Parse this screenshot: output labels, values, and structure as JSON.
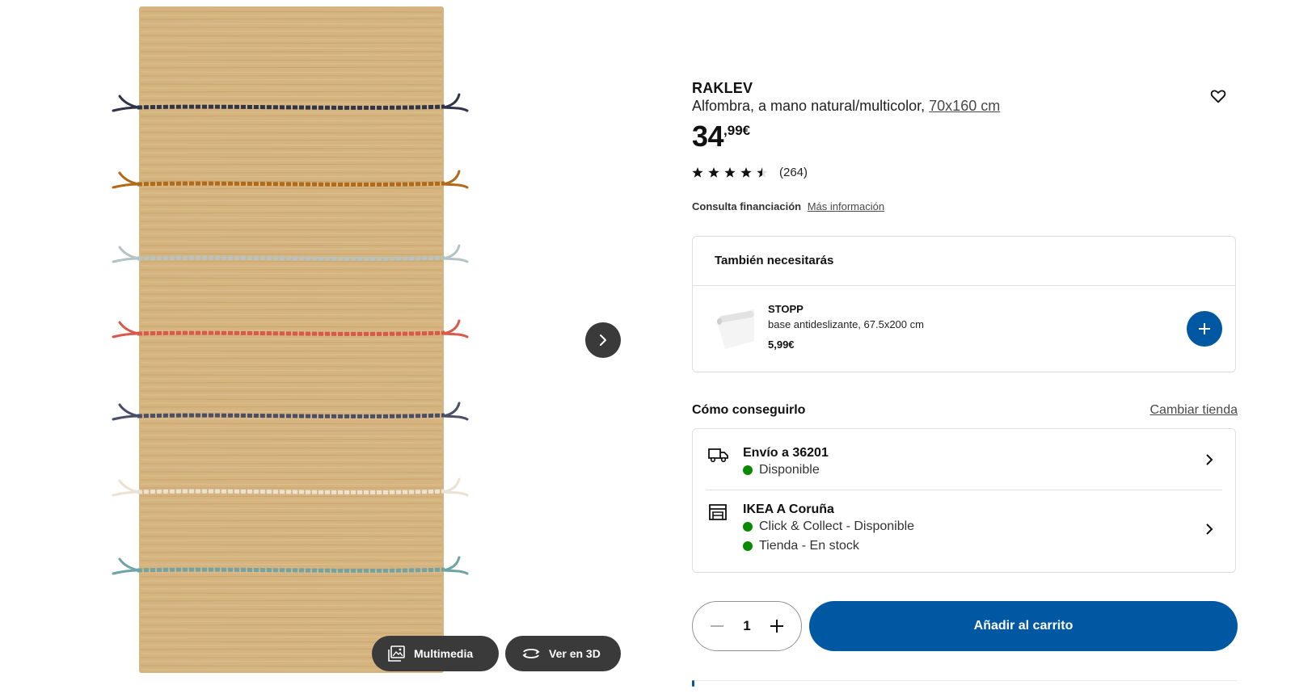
{
  "gallery": {
    "multimedia_label": "Multimedia",
    "view3d_label": "Ver en 3D",
    "stripe_colors": [
      "#2f3448",
      "#b06a18",
      "#b4c3c4",
      "#d9594a",
      "#4a4e66",
      "#ece2d2",
      "#6fa3a6"
    ],
    "rug_color": "#d5b47f"
  },
  "product": {
    "name": "RAKLEV",
    "description": "Alfombra, a mano natural/multicolor,",
    "size_link": "70x160 cm",
    "price_int": "34",
    "price_dec": ",99€",
    "rating_value": 4.5,
    "rating_count": "(264)"
  },
  "finance": {
    "label": "Consulta financiación",
    "link": "Más información"
  },
  "also_need": {
    "heading": "También necesitarás",
    "item": {
      "name": "STOPP",
      "description": "base antideslizante, 67.5x200 cm",
      "price": "5,99€"
    }
  },
  "availability": {
    "heading": "Cómo conseguirlo",
    "change_store": "Cambiar tienda",
    "delivery": {
      "title": "Envío a 36201",
      "status": "Disponible"
    },
    "store": {
      "title": "IKEA A Coruña",
      "status1": "Click & Collect - Disponible",
      "status2": "Tienda - En stock"
    },
    "status_color": "#0a8a00"
  },
  "purchase": {
    "quantity": "1",
    "add_to_cart": "Añadir al carrito",
    "accent_color": "#0058a3"
  }
}
